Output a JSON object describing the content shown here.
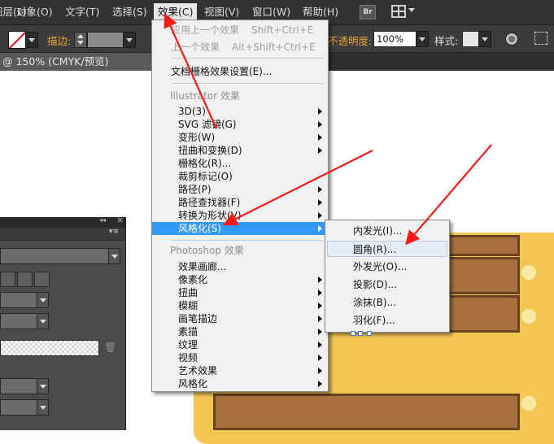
{
  "menubar": {
    "items": [
      "图层(L)",
      "对象(O)",
      "文字(T)",
      "选择(S)",
      "效果(C)",
      "视图(V)",
      "窗口(W)",
      "帮助(H)"
    ],
    "br_label": "Br"
  },
  "control": {
    "stroke_label": "描边:",
    "opacity_label": "不透明度:",
    "opacity_value": "100%",
    "style_label": "样式:"
  },
  "doc_tab": {
    "title": "@ 150% (CMYK/预览)",
    "close": "×"
  },
  "effect_menu": {
    "apply_last": "应用上一个效果",
    "apply_last_shortcut": "Shift+Ctrl+E",
    "last_effect": "上一个效果",
    "last_effect_shortcut": "Alt+Shift+Ctrl+E",
    "doc_raster_settings": "文档栅格效果设置(E)...",
    "illustrator_header": "Illustrator 效果",
    "illustrator_items": [
      "3D(3)",
      "SVG 滤镜(G)",
      "变形(W)",
      "扭曲和变换(D)",
      "栅格化(R)...",
      "裁剪标记(O)",
      "路径(P)",
      "路径查找器(F)",
      "转换为形状(V)",
      "风格化(S)"
    ],
    "photoshop_header": "Photoshop 效果",
    "photoshop_items": [
      "效果画廊...",
      "像素化",
      "扭曲",
      "模糊",
      "画笔描边",
      "素描",
      "纹理",
      "视频",
      "艺术效果",
      "风格化"
    ]
  },
  "stylize_submenu": {
    "items": [
      "内发光(I)...",
      "圆角(R)...",
      "外发光(O)...",
      "投影(D)...",
      "涂抹(B)...",
      "羽化(F)..."
    ]
  },
  "panel": {
    "trash": "🗑",
    "collapse": "◂◂",
    "menu": "▾≡",
    "close": "×"
  },
  "colors": {
    "highlight": "#3399ff",
    "arrow": "#ff1a1a",
    "artwork_yellow": "#f3c654",
    "plank": "#a8703f"
  }
}
